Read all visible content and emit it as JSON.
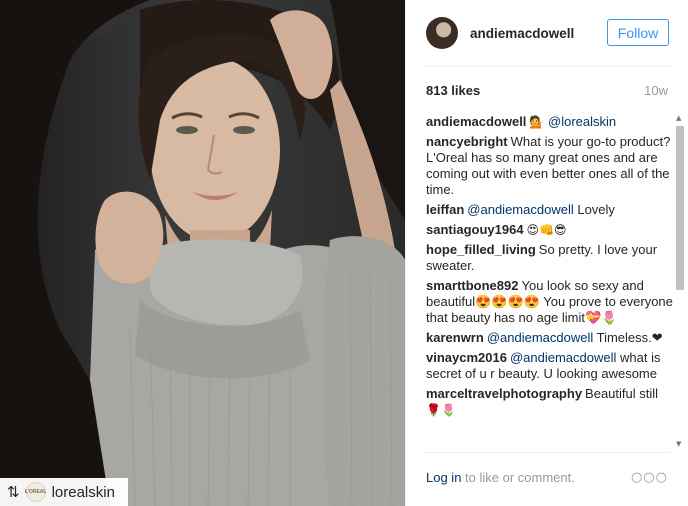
{
  "photo": {
    "regram_account": "lorealskin",
    "regram_avatar_text": "L'OREAL"
  },
  "post": {
    "author": "andiemacdowell",
    "follow_label": "Follow",
    "likes": "813 likes",
    "age": "10w"
  },
  "comments": [
    {
      "author": "andiemacdowell",
      "text": "",
      "emoji_before": "💁",
      "mention": "@lorealskin",
      "emoji_after": ""
    },
    {
      "author": "nancyebright",
      "text": "What is your go-to product? L'Oreal has so many great ones and are coming out with even better ones all of the time.",
      "emoji_before": "",
      "mention": "",
      "emoji_after": ""
    },
    {
      "author": "leiffan",
      "text": "Lovely",
      "emoji_before": "",
      "mention": "@andiemacdowell",
      "emoji_after": ""
    },
    {
      "author": "santiagouy1964",
      "text": "",
      "emoji_before": "😍👊😎",
      "mention": "",
      "emoji_after": ""
    },
    {
      "author": "hope_filled_living",
      "text": "So pretty. I love your sweater.",
      "emoji_before": "",
      "mention": "",
      "emoji_after": ""
    },
    {
      "author": "smarttbone892",
      "text": "You look so sexy and beautiful😍😍😍😍 You prove to everyone that beauty has no age limit💝🌷",
      "emoji_before": "",
      "mention": "",
      "emoji_after": ""
    },
    {
      "author": "karenwrn",
      "text": "Timeless.❤",
      "emoji_before": "",
      "mention": "@andiemacdowell",
      "emoji_after": ""
    },
    {
      "author": "vinaycm2016",
      "text": "what is secret of u r beauty. U looking awesome",
      "emoji_before": "",
      "mention": "@andiemacdowell",
      "emoji_after": ""
    },
    {
      "author": "marceltravelphotography",
      "text": "Beautiful still",
      "emoji_before": "",
      "mention": "",
      "emoji_after": "🌹🌷"
    }
  ],
  "footer": {
    "login_link": "Log in",
    "login_suffix": " to like or comment.",
    "more_icon": "more-icon"
  },
  "colors": {
    "link": "#003569",
    "follow": "#3897f0",
    "muted": "#999999"
  }
}
